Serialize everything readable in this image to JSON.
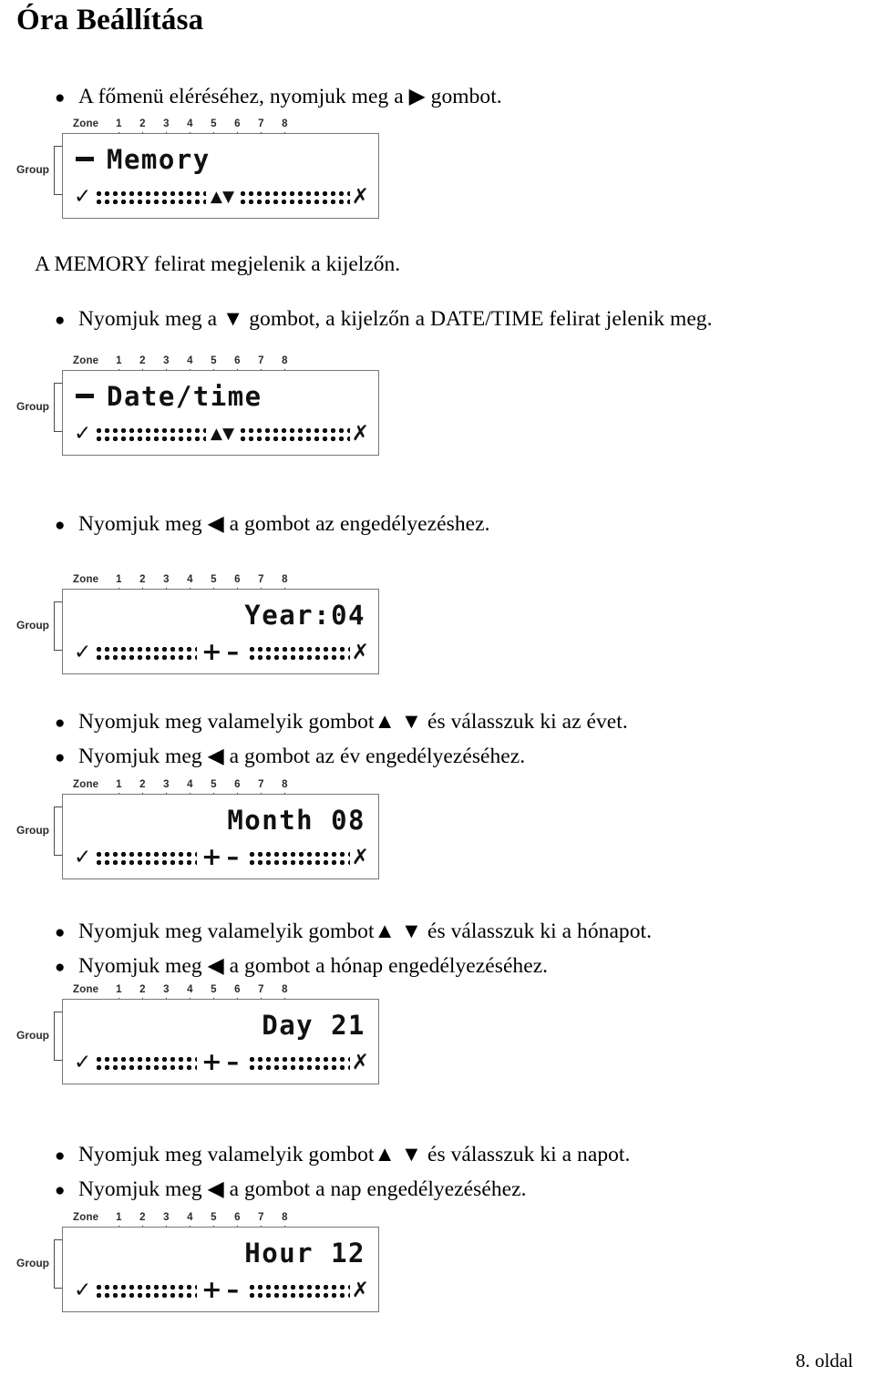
{
  "document": {
    "title": "Óra Beállítása",
    "footer": "8. oldal"
  },
  "steps": [
    {
      "bullets": [
        "A főmenü eléréséhez, nyomjuk meg a ▶ gombot."
      ]
    },
    {
      "plain": "A MEMORY felirat megjelenik a kijelzőn."
    },
    {
      "bullets": [
        "Nyomjuk meg a ▼ gombot, a kijelzőn a DATE/TIME felirat jelenik meg."
      ]
    },
    {
      "bullets": [
        "Nyomjuk meg ◀ a gombot az engedélyezéshez."
      ]
    },
    {
      "bullets": [
        "Nyomjuk meg valamelyik gombot▲ ▼ és válasszuk ki az évet.",
        "Nyomjuk meg ◀ a gombot az év engedélyezéséhez."
      ]
    },
    {
      "bullets": [
        "Nyomjuk meg valamelyik gombot▲ ▼ és válasszuk ki a hónapot.",
        "Nyomjuk meg ◀ a gombot a hónap engedélyezéséhez."
      ]
    },
    {
      "bullets": [
        "Nyomjuk meg valamelyik gombot▲ ▼ és válasszuk ki a napot.",
        "Nyomjuk meg ◀ a gombot a nap engedélyezéséhez."
      ]
    }
  ],
  "lcd_common": {
    "zone_label": "Zone",
    "zone_numbers": [
      "1",
      "2",
      "3",
      "4",
      "5",
      "6",
      "7",
      "8"
    ],
    "group_label": "Group",
    "ok_glyph": "✓",
    "cancel_glyph": "✗",
    "updown_glyph": "▲▼",
    "plus_glyph": "+",
    "minus_glyph": "–"
  },
  "lcd_panels": [
    {
      "id": "memory",
      "line_text": "Memory",
      "has_dash_prefix": true,
      "align": "left",
      "mid_mode": "updown"
    },
    {
      "id": "date-time",
      "line_text": "Date/time",
      "has_dash_prefix": true,
      "align": "left",
      "mid_mode": "updown"
    },
    {
      "id": "year",
      "line_text": "Year:04",
      "has_dash_prefix": false,
      "align": "right",
      "mid_mode": "plusminus"
    },
    {
      "id": "month",
      "line_text": "Month 08",
      "has_dash_prefix": false,
      "align": "right",
      "mid_mode": "plusminus"
    },
    {
      "id": "day",
      "line_text": "Day  21",
      "has_dash_prefix": false,
      "align": "right",
      "mid_mode": "plusminus"
    },
    {
      "id": "hour",
      "line_text": "Hour 12",
      "has_dash_prefix": false,
      "align": "right",
      "mid_mode": "plusminus"
    }
  ]
}
